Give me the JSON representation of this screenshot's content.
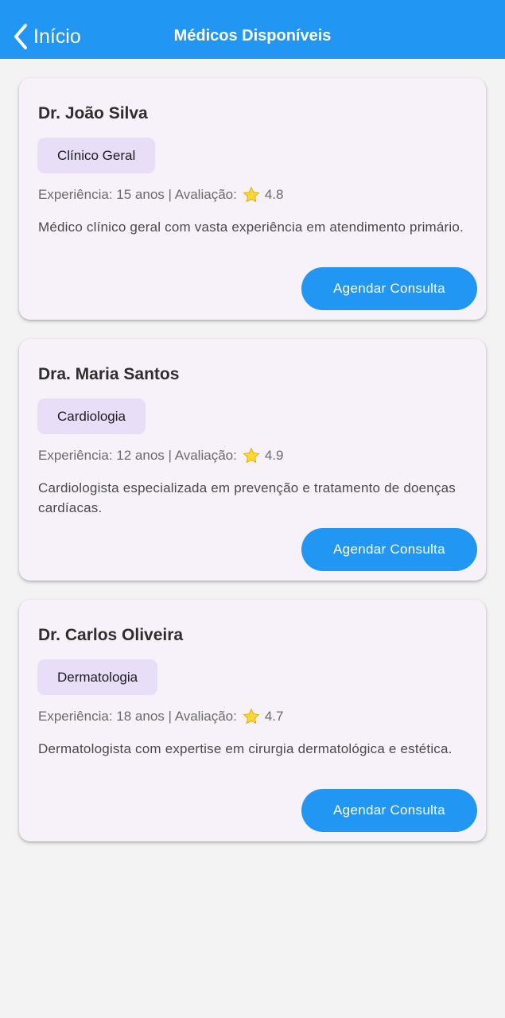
{
  "app_bar": {
    "back_label": "Início",
    "title": "Médicos Disponíveis",
    "color": "#2196f3"
  },
  "doctors": [
    {
      "name": "Dr. João Silva",
      "specialty": "Clínico Geral",
      "experience": "Experiência: 15 anos | Avaliação:",
      "rating": "4.8",
      "description": "Médico clínico geral com vasta experiência em atendimento primário.",
      "button_label": "Agendar Consulta"
    },
    {
      "name": "Dra. Maria Santos",
      "specialty": "Cardiologia",
      "experience": "Experiência: 12 anos | Avaliação:",
      "rating": "4.9",
      "description": "Cardiologista especializada em prevenção e tratamento de doenças cardíacas.",
      "button_label": "Agendar Consulta"
    },
    {
      "name": "Dr. Carlos Oliveira",
      "specialty": "Dermatologia",
      "experience": "Experiência: 18 anos | Avaliação:",
      "rating": "4.7",
      "description": "Dermatologista com expertise em cirurgia dermatológica e estética.",
      "button_label": "Agendar Consulta"
    }
  ],
  "icons": {
    "back": "chevron-left-icon",
    "rating": "star-icon"
  }
}
